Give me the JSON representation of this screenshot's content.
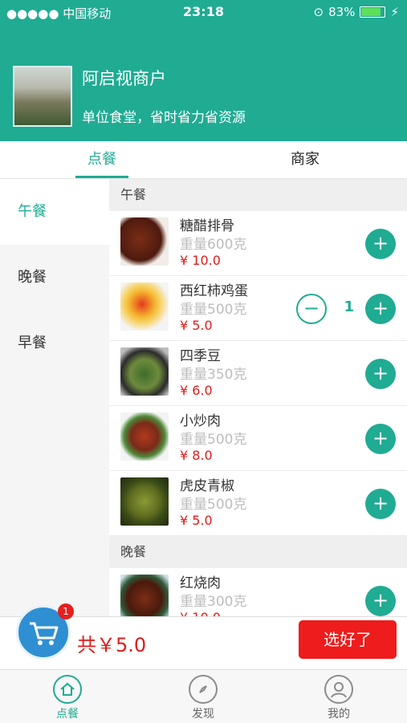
{
  "status": {
    "carrier": "●●●●● 中国移动",
    "time": "23:18",
    "battery": "83%"
  },
  "shop": {
    "name": "阿启视商户",
    "slogan": "单位食堂，省时省力省资源"
  },
  "tabs": [
    "点餐",
    "商家"
  ],
  "sidebar": [
    "午餐",
    "晚餐",
    "早餐"
  ],
  "sections": [
    {
      "title": "午餐",
      "dishes": [
        {
          "name": "糖醋排骨",
          "weight": "重量600克",
          "price": "¥ 10.0"
        },
        {
          "name": "西红柿鸡蛋",
          "weight": "重量500克",
          "price": "¥ 5.0",
          "qty": "1"
        },
        {
          "name": "四季豆",
          "weight": "重量350克",
          "price": "¥ 6.0"
        },
        {
          "name": "小炒肉",
          "weight": "重量500克",
          "price": "¥ 8.0"
        },
        {
          "name": "虎皮青椒",
          "weight": "重量500克",
          "price": "¥ 5.0"
        }
      ]
    },
    {
      "title": "晚餐",
      "dishes": [
        {
          "name": "红烧肉",
          "weight": "重量300克",
          "price": "¥ 10.0"
        }
      ]
    }
  ],
  "cart": {
    "count": "1",
    "total": "共￥5.0",
    "submit": "选好了"
  },
  "nav": [
    "点餐",
    "发现",
    "我的"
  ],
  "colors": {
    "primary": "#20ab93",
    "price": "#e01b1b",
    "submit": "#ee1c1c"
  }
}
